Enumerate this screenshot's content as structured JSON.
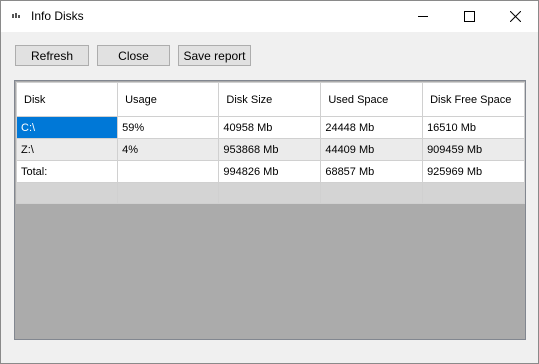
{
  "window": {
    "title": "Info Disks"
  },
  "toolbar": {
    "refresh_label": "Refresh",
    "close_label": "Close",
    "save_label": "Save report"
  },
  "table": {
    "columns": [
      "Disk",
      "Usage",
      "Disk Size",
      "Used Space",
      "Disk Free Space"
    ],
    "rows": [
      [
        "C:\\",
        "59%",
        "40958 Mb",
        "24448 Mb",
        "16510 Mb"
      ],
      [
        "Z:\\",
        "4%",
        "953868 Mb",
        "44409 Mb",
        "909459 Mb"
      ],
      [
        "Total:",
        "",
        "994826 Mb",
        "68857 Mb",
        "925969 Mb"
      ]
    ],
    "selected_cell": "C:\\"
  },
  "colors": {
    "selection": "#0078d7",
    "grid_background": "#ababab"
  }
}
